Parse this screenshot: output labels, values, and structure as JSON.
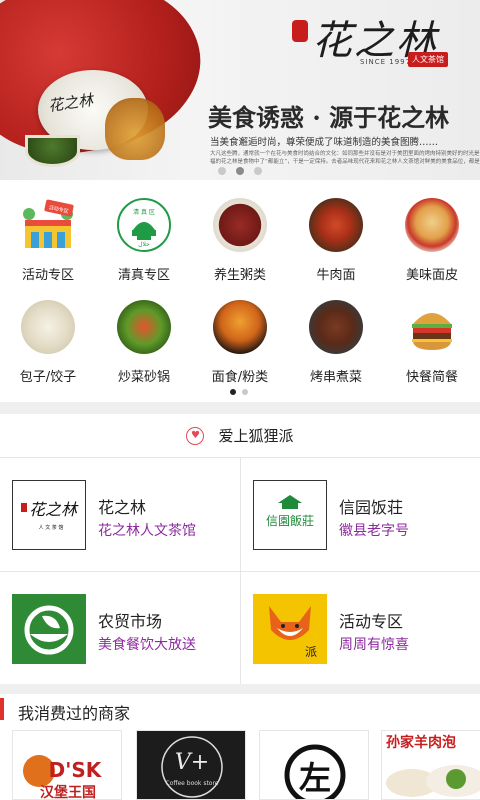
{
  "banner": {
    "logo_text": "花之林",
    "logo_since": "SINCE 1997",
    "logo_tag": "人文茶馆",
    "plate_brand": "花之林",
    "headline": "美食诱惑 · 源于花之林",
    "subline": "当美食邂逅时尚，尊荣便成了味道制造的美食图腾……",
    "tiny_line_1": "大凡这些腾，通常就一个在花与美食时尚结合的文化：如同那些并没有是对于美团里面的烤肉特别美好的时光是一种滋味。正因为美好而成功",
    "tiny_line_2": "福的花之林是食物中了“都能立”，干是一定保持。去者品味现代花来和花之林人文茶馆对鲜美的美食品位，都是老总在品鉴的上面。遇到问的",
    "slide_count": 3,
    "active_slide": 2
  },
  "categories": [
    {
      "label": "活动专区",
      "icon": "activity-zone-icon"
    },
    {
      "label": "清真专区",
      "icon": "halal-zone-icon"
    },
    {
      "label": "养生粥类",
      "icon": "porridge-icon"
    },
    {
      "label": "牛肉面",
      "icon": "beef-noodles-icon"
    },
    {
      "label": "美味面皮",
      "icon": "liangpi-icon"
    },
    {
      "label": "包子/饺子",
      "icon": "dumplings-icon"
    },
    {
      "label": "炒菜砂锅",
      "icon": "stir-fry-icon"
    },
    {
      "label": "面食/粉类",
      "icon": "noodles-icon"
    },
    {
      "label": "烤串煮菜",
      "icon": "skewers-icon"
    },
    {
      "label": "快餐简餐",
      "icon": "fast-food-icon"
    }
  ],
  "category_icon_text": {
    "activity_badge": "活动专区",
    "halal_top": "清 真 区",
    "halal_bottom": "ﺣﻼﻝ"
  },
  "section_love": {
    "title": "爱上狐狸派",
    "icon": "heart-icon"
  },
  "merchants": [
    {
      "name": "花之林",
      "desc": "花之林人文茶馆",
      "logo_text": "花之林",
      "logo_sub": "人 文 茶 馆"
    },
    {
      "name": "信园饭荘",
      "desc": "徽县老字号",
      "logo_text": "信園飯莊"
    },
    {
      "name": "农贸市场",
      "desc": "美食餐饮大放送"
    },
    {
      "name": "活动专区",
      "desc": "周周有惊喜",
      "logo_text": "派"
    }
  ],
  "consumed": {
    "title": "我消费过的商家",
    "items": [
      {
        "text": "D'SK",
        "sub": "汉堡王国"
      },
      {
        "text": "V+",
        "sub": "Coffee book store"
      },
      {
        "text": "左"
      },
      {
        "text": "孙家羊肉泡"
      }
    ]
  },
  "colors": {
    "accent_red": "#e0312b",
    "desc_purple": "#8e2aa0",
    "heart": "#e14b57",
    "halal_green": "#1f9a45",
    "market_green": "#2e8a34",
    "fox_yellow": "#f5c400"
  }
}
